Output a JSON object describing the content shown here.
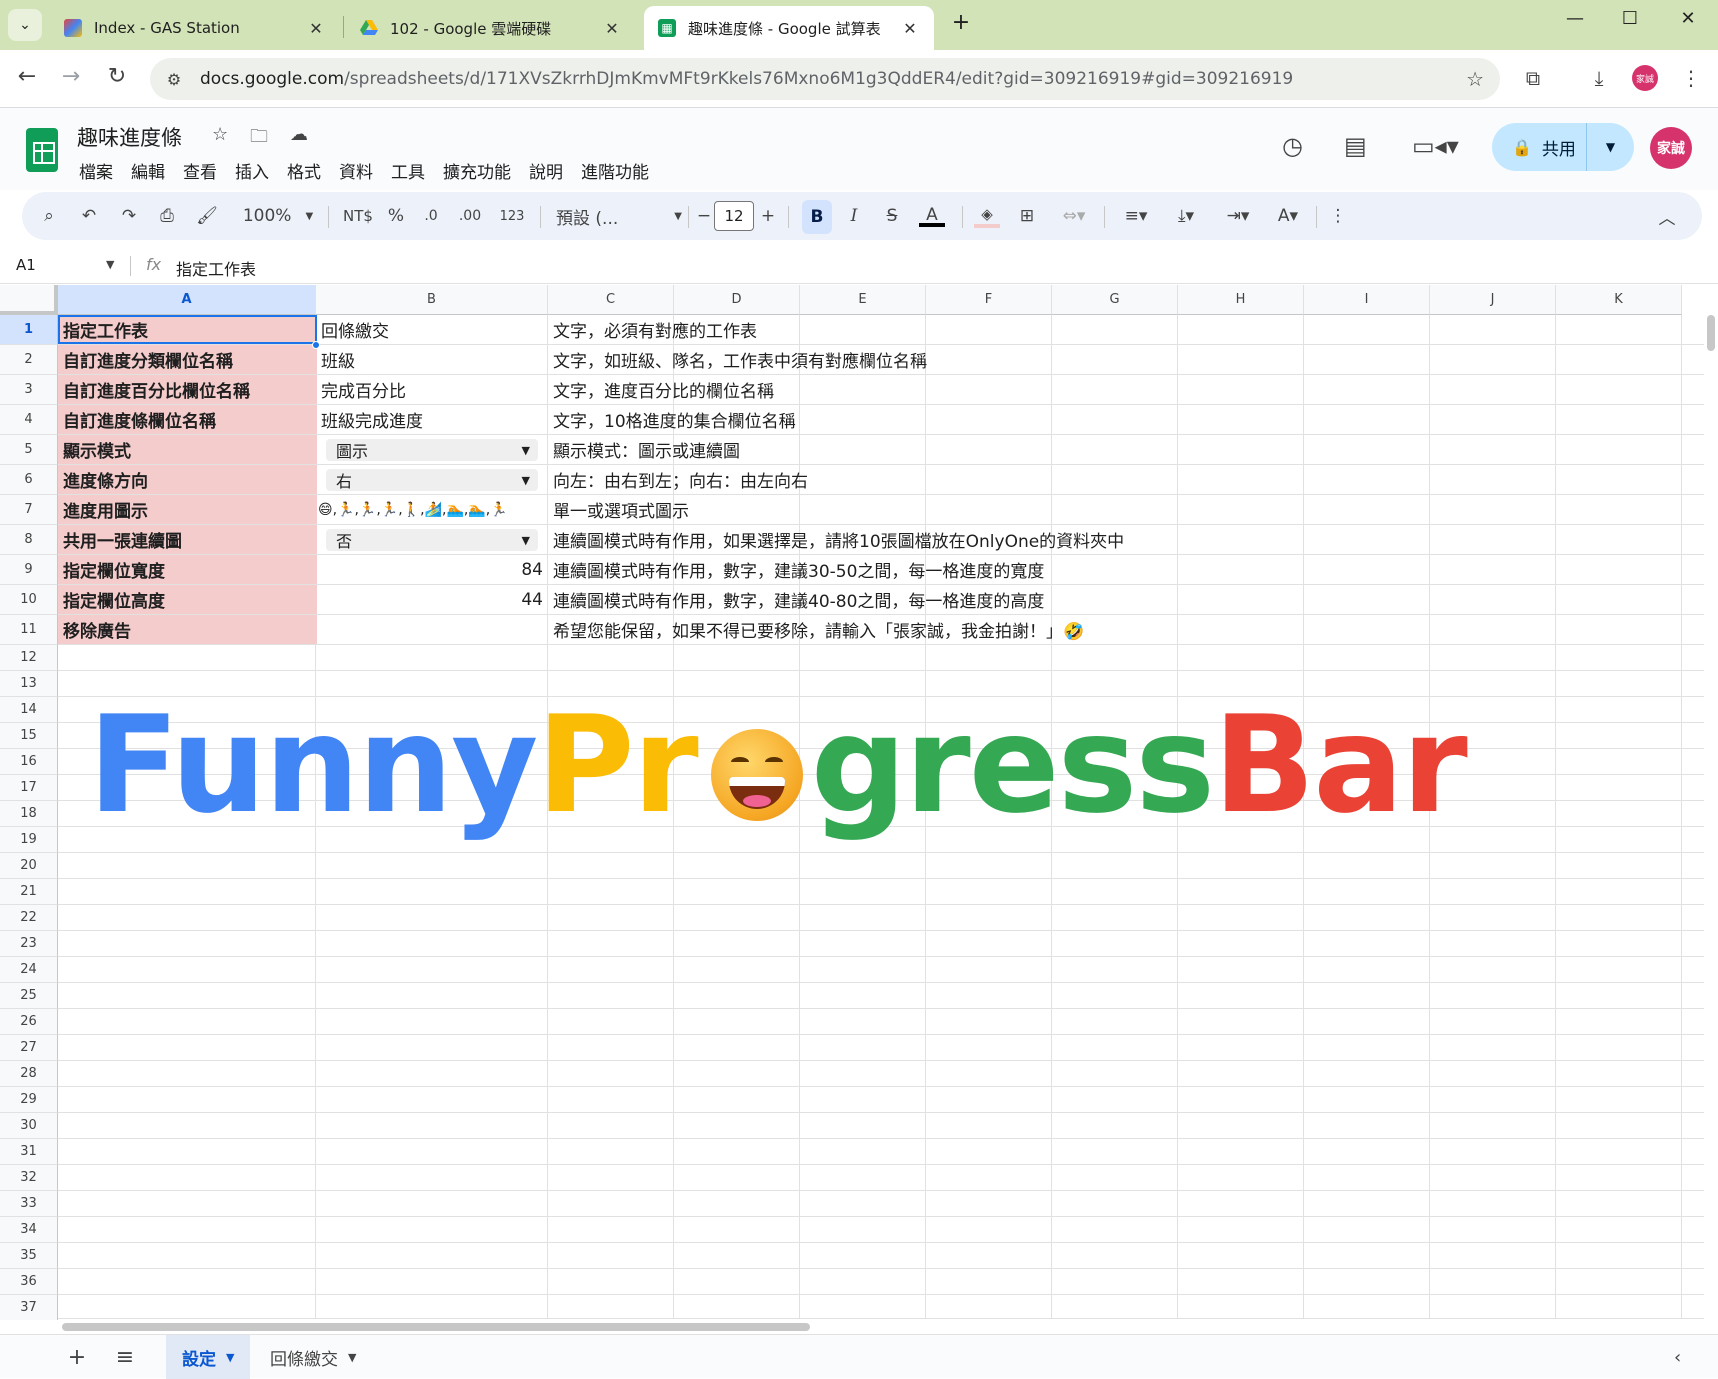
{
  "browser": {
    "tabs": [
      {
        "title": "Index - GAS Station",
        "close": "✕"
      },
      {
        "title": "102 - Google 雲端硬碟",
        "close": "✕"
      },
      {
        "title": "趣味進度條 - Google 試算表",
        "close": "✕"
      }
    ],
    "new_tab": "+",
    "window": {
      "minimize": "—",
      "maximize": "☐",
      "close": "✕"
    },
    "url_host": "docs.google.com",
    "url_path": "/spreadsheets/d/171XVsZkrrhDJmKmvMFt9rKkels76Mxno6M1g3QddER4/edit?gid=309216919#gid=309216919",
    "profile_label": "家誠"
  },
  "sheets": {
    "doc_title": "趣味進度條",
    "menu": [
      "檔案",
      "編輯",
      "查看",
      "插入",
      "格式",
      "資料",
      "工具",
      "擴充功能",
      "說明",
      "進階功能"
    ],
    "share_label": "共用",
    "avatar_label": "家誠",
    "toolbar": {
      "zoom": "100%",
      "currency": "NT$",
      "percent": "%",
      "dec_decrease": ".0",
      "dec_increase": ".00",
      "number_format": "123",
      "font": "預設 (...",
      "font_size": "12",
      "bold": "B",
      "italic": "I",
      "strike": "S",
      "text_color": "A"
    },
    "name_box": "A1",
    "formula_content": "指定工作表"
  },
  "grid": {
    "columns": [
      "A",
      "B",
      "C",
      "D",
      "E",
      "F",
      "G",
      "H",
      "I",
      "J",
      "K"
    ],
    "rows": [
      {
        "num": "1",
        "label": "指定工作表",
        "value": "回條繳交",
        "desc": "文字，必須有對應的工作表"
      },
      {
        "num": "2",
        "label": "自訂進度分類欄位名稱",
        "value": "班級",
        "desc": "文字，如班級、隊名，工作表中須有對應欄位名稱"
      },
      {
        "num": "3",
        "label": "自訂進度百分比欄位名稱",
        "value": "完成百分比",
        "desc": "文字，進度百分比的欄位名稱"
      },
      {
        "num": "4",
        "label": "自訂進度條欄位名稱",
        "value": "班級完成進度",
        "desc": "文字，10格進度的集合欄位名稱"
      },
      {
        "num": "5",
        "label": "顯示模式",
        "value": "圖示",
        "desc": "顯示模式：圖示或連續圖"
      },
      {
        "num": "6",
        "label": "進度條方向",
        "value": "右",
        "desc": "向左：由右到左；向右：由左向右"
      },
      {
        "num": "7",
        "label": "進度用圖示",
        "value": "😄,🏃,🏃,🏃,🚶,🏄,🏊,🏊,🏃",
        "desc": "單一或選項式圖示"
      },
      {
        "num": "8",
        "label": "共用一張連續圖",
        "value": "否",
        "desc": "連續圖模式時有作用，如果選擇是，請將10張圖檔放在OnlyOne的資料夾中"
      },
      {
        "num": "9",
        "label": "指定欄位寬度",
        "value": "84",
        "desc": "連續圖模式時有作用，數字，建議30-50之間，每一格進度的寬度"
      },
      {
        "num": "10",
        "label": "指定欄位高度",
        "value": "44",
        "desc": "連續圖模式時有作用，數字，建議40-80之間，每一格進度的高度"
      },
      {
        "num": "11",
        "label": "移除廣告",
        "value": "",
        "desc": "希望您能保留，如果不得已要移除，請輸入「張家誠，我金拍謝！」🤣"
      }
    ],
    "extra_rows": [
      "12",
      "13",
      "14",
      "15",
      "16",
      "17",
      "18",
      "19",
      "20",
      "21",
      "22",
      "23",
      "24",
      "25",
      "26",
      "27",
      "28",
      "29",
      "30",
      "31",
      "32",
      "33",
      "34",
      "35",
      "36",
      "37"
    ]
  },
  "banner": {
    "part1": "Funny",
    "part2": "Pr",
    "part3": "gress",
    "part4": "Bar",
    "colors": {
      "blue": "#4285f4",
      "yellow": "#fbbc05",
      "green": "#34a853",
      "red": "#ea4335"
    }
  },
  "sheet_tabs": [
    {
      "label": "設定",
      "active": true
    },
    {
      "label": "回條繳交",
      "active": false
    }
  ],
  "colors": {
    "label_fill": "#f4cccc",
    "selection": "#1a73e8",
    "share_bg": "#c2e7ff",
    "tab_strip": "#d3e3b8"
  }
}
